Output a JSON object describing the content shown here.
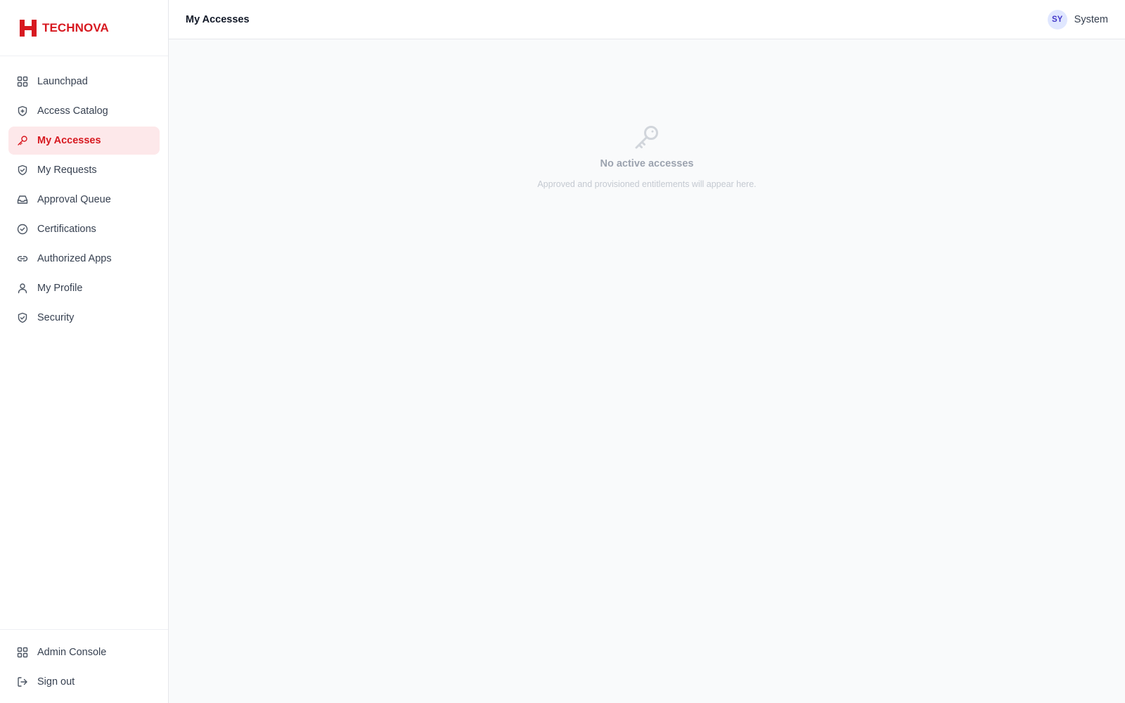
{
  "brand": {
    "name": "TECHNOVA",
    "color": "#d71920",
    "logo_icon": "technova-logo"
  },
  "sidebar": {
    "items": [
      {
        "label": "Launchpad",
        "icon": "grid-icon",
        "active": false
      },
      {
        "label": "Access Catalog",
        "icon": "shield-plus-icon",
        "active": false
      },
      {
        "label": "My Accesses",
        "icon": "key-icon",
        "active": true
      },
      {
        "label": "My Requests",
        "icon": "shield-check-icon",
        "active": false
      },
      {
        "label": "Approval Queue",
        "icon": "inbox-icon",
        "active": false
      },
      {
        "label": "Certifications",
        "icon": "circle-check-icon",
        "active": false
      },
      {
        "label": "Authorized Apps",
        "icon": "link-icon",
        "active": false
      },
      {
        "label": "My Profile",
        "icon": "user-icon",
        "active": false
      },
      {
        "label": "Security",
        "icon": "shield-check-icon",
        "active": false
      }
    ],
    "bottom_items": [
      {
        "label": "Admin Console",
        "icon": "grid-icon"
      },
      {
        "label": "Sign out",
        "icon": "logout-icon"
      }
    ]
  },
  "header": {
    "title": "My Accesses",
    "user": {
      "initials": "SY",
      "name": "System"
    }
  },
  "empty_state": {
    "icon": "key-icon",
    "title": "No active accesses",
    "subtitle": "Approved and provisioned entitlements will appear here."
  }
}
